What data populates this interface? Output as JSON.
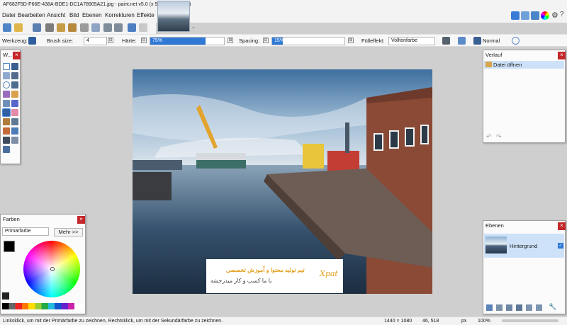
{
  "window": {
    "title": "AF682F5D-F66E-438A-BDE1-DC1A78905A21.jpg - paint.net v5.0 (x 5.0.6361.33457)"
  },
  "menu": [
    "Datei",
    "Bearbeiten",
    "Ansicht",
    "Bild",
    "Ebenen",
    "Korrekturen",
    "Effekte"
  ],
  "toolbar": {
    "tool_label": "Werkzeug:",
    "brush_size_label": "Brush size:",
    "brush_size_value": "4",
    "hardness_label": "Härte:",
    "hardness_value": "75%",
    "hardness_level": 0.75,
    "spacing_label": "Spacing:",
    "spacing_value": "15%",
    "spacing_level": 0.15,
    "fill_label": "Fülleffekt:",
    "fill_value": "Vollton­farbe",
    "blend_mode": "Normal",
    "minus": "⊟",
    "plus": "⊞"
  },
  "tools_panel": {
    "title": "W..."
  },
  "colors_panel": {
    "title": "Farben",
    "select_value": "Primärfarbe",
    "more_button": "Mehr >>"
  },
  "history_panel": {
    "title": "Verlauf",
    "items": [
      {
        "label": "Datei öffnen"
      }
    ]
  },
  "layers_panel": {
    "title": "Ebenen",
    "layers": [
      {
        "name": "Hintergrund",
        "visible": true
      }
    ]
  },
  "watermark": {
    "line1": "تیم تولید محتوا و آموزش تخصصی",
    "line2": "با ما کسب و کار مید‌رخشه",
    "logo_text": "Xpat"
  },
  "status": {
    "hint": "Linksklick, um mit der Primärfarbe zu zeichnen, Rechtsklick, um mit der Sekundärfarbe zu zeichnen.",
    "image_size": "1440 × 1080",
    "cursor_pos": "46, 518",
    "unit": "px",
    "zoom": "100%"
  },
  "colors": {
    "accent": "#2f78d6",
    "close": "#c4272a",
    "primary": "#000000",
    "secondary": "#ffffff"
  }
}
